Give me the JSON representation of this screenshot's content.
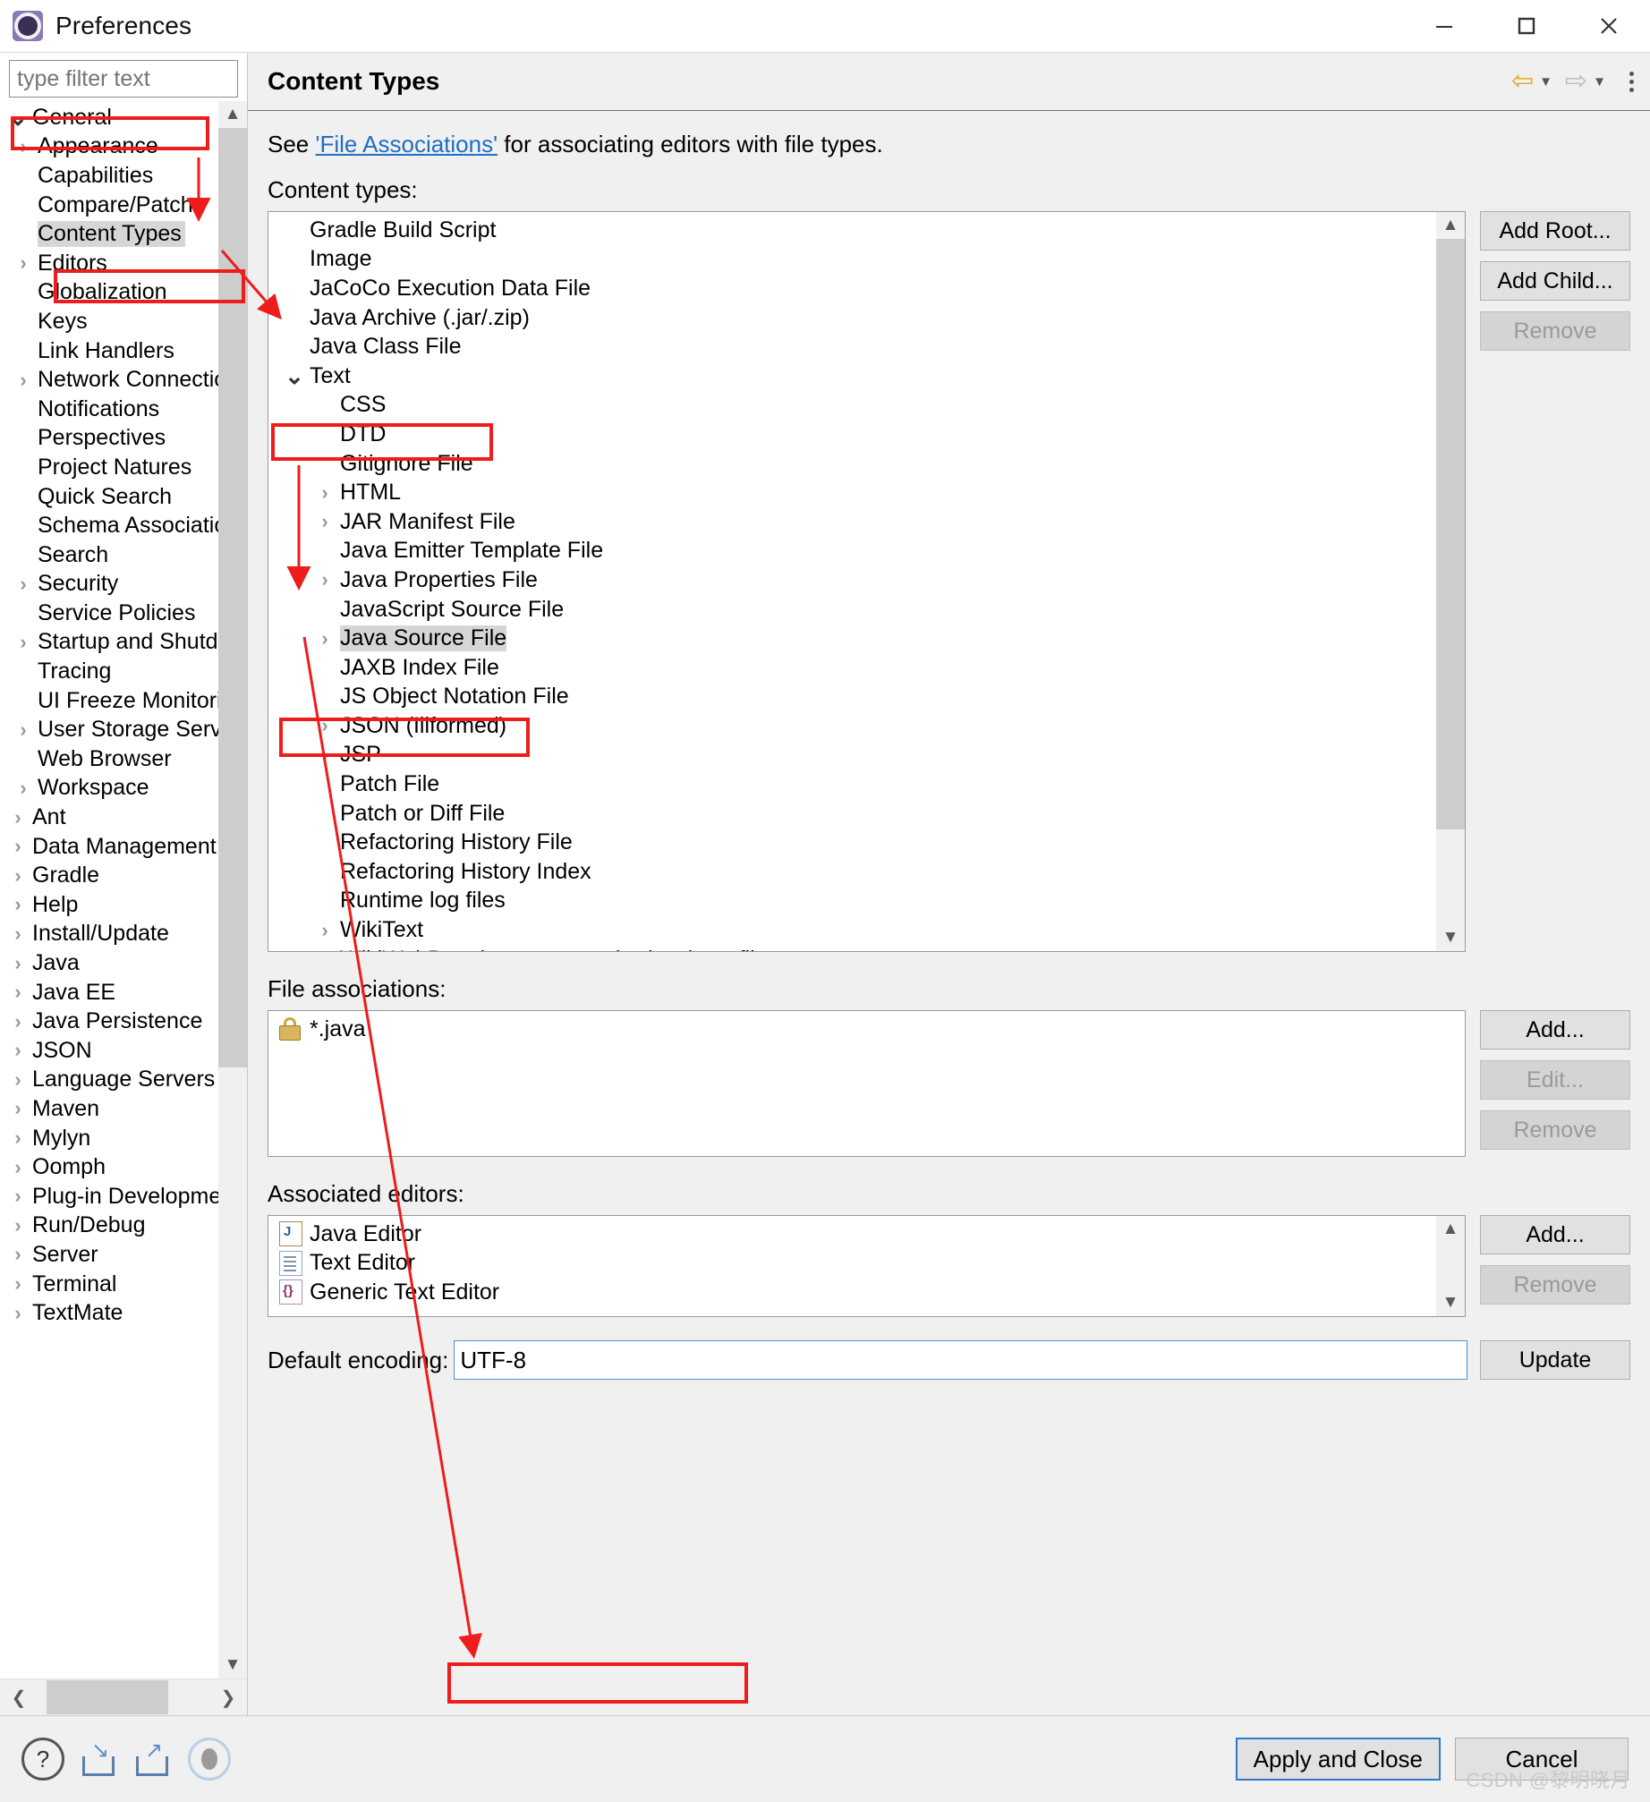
{
  "window": {
    "title": "Preferences",
    "icon": "preferences-gear-icon",
    "controls": {
      "minimize": "minimize-icon",
      "maximize": "maximize-icon",
      "close": "close-icon"
    }
  },
  "sidebar": {
    "filter_placeholder": "type filter text",
    "filter_value": "",
    "selected": "Content Types",
    "items": [
      {
        "label": "General",
        "depth": 0,
        "twisty": "expanded"
      },
      {
        "label": "Appearance",
        "depth": 1,
        "twisty": "collapsed"
      },
      {
        "label": "Capabilities",
        "depth": 1,
        "twisty": "none"
      },
      {
        "label": "Compare/Patch",
        "depth": 1,
        "twisty": "none"
      },
      {
        "label": "Content Types",
        "depth": 1,
        "twisty": "none",
        "selected": true
      },
      {
        "label": "Editors",
        "depth": 1,
        "twisty": "collapsed"
      },
      {
        "label": "Globalization",
        "depth": 1,
        "twisty": "none"
      },
      {
        "label": "Keys",
        "depth": 1,
        "twisty": "none"
      },
      {
        "label": "Link Handlers",
        "depth": 1,
        "twisty": "none"
      },
      {
        "label": "Network Connections",
        "depth": 1,
        "twisty": "collapsed"
      },
      {
        "label": "Notifications",
        "depth": 1,
        "twisty": "none"
      },
      {
        "label": "Perspectives",
        "depth": 1,
        "twisty": "none"
      },
      {
        "label": "Project Natures",
        "depth": 1,
        "twisty": "none"
      },
      {
        "label": "Quick Search",
        "depth": 1,
        "twisty": "none"
      },
      {
        "label": "Schema Associations",
        "depth": 1,
        "twisty": "none"
      },
      {
        "label": "Search",
        "depth": 1,
        "twisty": "none"
      },
      {
        "label": "Security",
        "depth": 1,
        "twisty": "collapsed"
      },
      {
        "label": "Service Policies",
        "depth": 1,
        "twisty": "none"
      },
      {
        "label": "Startup and Shutdown",
        "depth": 1,
        "twisty": "collapsed"
      },
      {
        "label": "Tracing",
        "depth": 1,
        "twisty": "none"
      },
      {
        "label": "UI Freeze Monitoring",
        "depth": 1,
        "twisty": "none"
      },
      {
        "label": "User Storage Service",
        "depth": 1,
        "twisty": "collapsed"
      },
      {
        "label": "Web Browser",
        "depth": 1,
        "twisty": "none"
      },
      {
        "label": "Workspace",
        "depth": 1,
        "twisty": "collapsed"
      },
      {
        "label": "Ant",
        "depth": 0,
        "twisty": "collapsed"
      },
      {
        "label": "Data Management",
        "depth": 0,
        "twisty": "collapsed"
      },
      {
        "label": "Gradle",
        "depth": 0,
        "twisty": "collapsed"
      },
      {
        "label": "Help",
        "depth": 0,
        "twisty": "collapsed"
      },
      {
        "label": "Install/Update",
        "depth": 0,
        "twisty": "collapsed"
      },
      {
        "label": "Java",
        "depth": 0,
        "twisty": "collapsed"
      },
      {
        "label": "Java EE",
        "depth": 0,
        "twisty": "collapsed"
      },
      {
        "label": "Java Persistence",
        "depth": 0,
        "twisty": "collapsed"
      },
      {
        "label": "JSON",
        "depth": 0,
        "twisty": "collapsed"
      },
      {
        "label": "Language Servers",
        "depth": 0,
        "twisty": "collapsed"
      },
      {
        "label": "Maven",
        "depth": 0,
        "twisty": "collapsed"
      },
      {
        "label": "Mylyn",
        "depth": 0,
        "twisty": "collapsed"
      },
      {
        "label": "Oomph",
        "depth": 0,
        "twisty": "collapsed"
      },
      {
        "label": "Plug-in Development",
        "depth": 0,
        "twisty": "collapsed"
      },
      {
        "label": "Run/Debug",
        "depth": 0,
        "twisty": "collapsed"
      },
      {
        "label": "Server",
        "depth": 0,
        "twisty": "collapsed"
      },
      {
        "label": "Terminal",
        "depth": 0,
        "twisty": "collapsed"
      },
      {
        "label": "TextMate",
        "depth": 0,
        "twisty": "collapsed"
      }
    ]
  },
  "page": {
    "title": "Content Types",
    "description_prefix": "See ",
    "description_link": "'File Associations'",
    "description_suffix": " for associating editors with file types.",
    "content_types_label": "Content types:",
    "file_associations_label": "File associations:",
    "associated_editors_label": "Associated editors:",
    "encoding_label": "Default encoding:",
    "encoding_value": "UTF-8",
    "update_button": "Update"
  },
  "content_types": {
    "selected": "Java Source File",
    "items": [
      {
        "label": "Gradle Build Script",
        "depth": 1,
        "twisty": "none"
      },
      {
        "label": "Image",
        "depth": 1,
        "twisty": "none"
      },
      {
        "label": "JaCoCo Execution Data File",
        "depth": 1,
        "twisty": "none"
      },
      {
        "label": "Java Archive (.jar/.zip)",
        "depth": 1,
        "twisty": "none"
      },
      {
        "label": "Java Class File",
        "depth": 1,
        "twisty": "none"
      },
      {
        "label": "Text",
        "depth": 1,
        "twisty": "expanded"
      },
      {
        "label": "CSS",
        "depth": 2,
        "twisty": "none"
      },
      {
        "label": "DTD",
        "depth": 2,
        "twisty": "none"
      },
      {
        "label": "Gitignore File",
        "depth": 2,
        "twisty": "none"
      },
      {
        "label": "HTML",
        "depth": 2,
        "twisty": "collapsed"
      },
      {
        "label": "JAR Manifest File",
        "depth": 2,
        "twisty": "collapsed"
      },
      {
        "label": "Java Emitter Template File",
        "depth": 2,
        "twisty": "none"
      },
      {
        "label": "Java Properties File",
        "depth": 2,
        "twisty": "collapsed"
      },
      {
        "label": "JavaScript Source File",
        "depth": 2,
        "twisty": "none"
      },
      {
        "label": "Java Source File",
        "depth": 2,
        "twisty": "collapsed",
        "selected": true
      },
      {
        "label": "JAXB Index File",
        "depth": 2,
        "twisty": "none"
      },
      {
        "label": "JS Object Notation File",
        "depth": 2,
        "twisty": "none"
      },
      {
        "label": "JSON (Illformed)",
        "depth": 2,
        "twisty": "collapsed"
      },
      {
        "label": "JSP",
        "depth": 2,
        "twisty": "collapsed"
      },
      {
        "label": "Patch File",
        "depth": 2,
        "twisty": "none"
      },
      {
        "label": "Patch or Diff File",
        "depth": 2,
        "twisty": "none"
      },
      {
        "label": "Refactoring History File",
        "depth": 2,
        "twisty": "none"
      },
      {
        "label": "Refactoring History Index",
        "depth": 2,
        "twisty": "none"
      },
      {
        "label": "Runtime log files",
        "depth": 2,
        "twisty": "none"
      },
      {
        "label": "WikiText",
        "depth": 2,
        "twisty": "collapsed"
      },
      {
        "label": "WikiWebDevelopment standard web profile",
        "depth": 2,
        "twisty": "none"
      }
    ],
    "buttons": [
      {
        "label": "Add Root...",
        "disabled": false
      },
      {
        "label": "Add Child...",
        "disabled": false
      },
      {
        "label": "Remove",
        "disabled": true
      }
    ]
  },
  "file_associations": {
    "items": [
      {
        "label": "*.java",
        "icon": "lock-icon"
      }
    ],
    "buttons": [
      {
        "label": "Add...",
        "disabled": false
      },
      {
        "label": "Edit...",
        "disabled": true
      },
      {
        "label": "Remove",
        "disabled": true
      }
    ]
  },
  "associated_editors": {
    "items": [
      {
        "label": "Java Editor",
        "icon": "java-editor-icon"
      },
      {
        "label": "Text Editor",
        "icon": "text-editor-icon"
      },
      {
        "label": "Generic Text Editor",
        "icon": "generic-text-editor-icon"
      }
    ],
    "buttons": [
      {
        "label": "Add...",
        "disabled": false
      },
      {
        "label": "Remove",
        "disabled": true
      }
    ]
  },
  "footer": {
    "icons": [
      "help-icon",
      "import-icon",
      "export-icon",
      "restore-defaults-icon"
    ],
    "apply_and_close": "Apply and Close",
    "cancel": "Cancel"
  },
  "watermark": "CSDN @黎明晓月",
  "colors": {
    "annotation": "#ee1c1c",
    "link": "#1f6fc4",
    "focus": "#2a7ad2",
    "selection": "#d6d6d6"
  }
}
